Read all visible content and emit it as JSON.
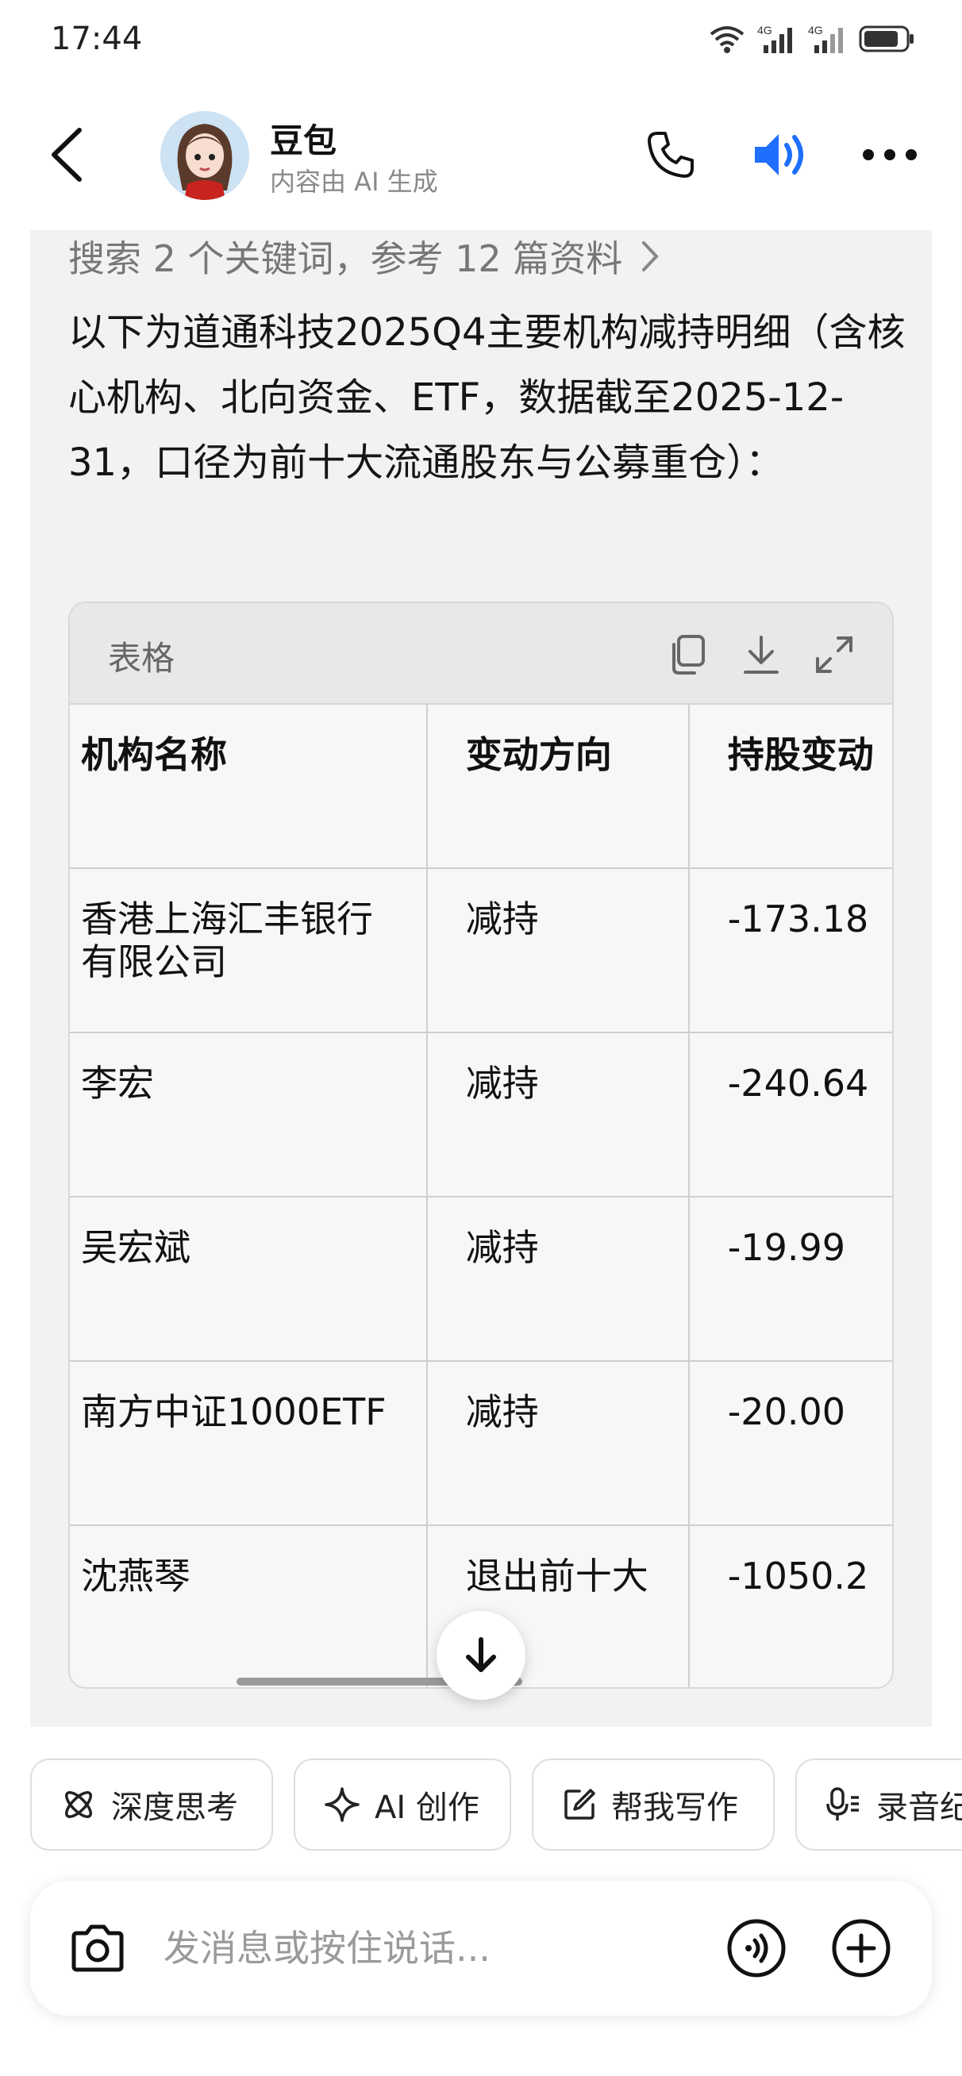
{
  "status_bar": {
    "time": "17:44",
    "icons": [
      "wifi-icon",
      "signal-4g-icon",
      "signal-4g-icon",
      "battery-icon"
    ]
  },
  "header": {
    "bot_name": "豆包",
    "subtitle": "内容由 AI 生成",
    "icons": [
      "back-icon",
      "phone-icon",
      "speaker-icon",
      "more-icon"
    ],
    "accent_color": "#1e6fff"
  },
  "message": {
    "search_reference": "搜索 2 个关键词，参考 12 篇资料",
    "text": "以下为道通科技2025Q4主要机构减持明细（含核心机构、北向资金、ETF，数据截至2025-12-31，口径为前十大流通股东与公募重仓）："
  },
  "table": {
    "toolbar_label": "表格",
    "toolbar_icons": [
      "copy-icon",
      "download-icon",
      "expand-icon"
    ],
    "headers": [
      "机构名称",
      "变动方向",
      "持股变动"
    ],
    "rows": [
      [
        "香港上海汇丰银行有限公司",
        "减持",
        "-173.18"
      ],
      [
        "李宏",
        "减持",
        "-240.64"
      ],
      [
        "吴宏斌",
        "减持",
        "-19.99"
      ],
      [
        "南方中证1000ETF",
        "减持",
        "-20.00"
      ],
      [
        "沈燕琴",
        "退出前十大",
        "-1050.2"
      ]
    ]
  },
  "chips": [
    {
      "label": "深度思考",
      "icon": "atom-icon"
    },
    {
      "label": "AI 创作",
      "icon": "sparkle-icon"
    },
    {
      "label": "帮我写作",
      "icon": "edit-icon"
    },
    {
      "label": "录音纪要",
      "icon": "mic-icon"
    }
  ],
  "input": {
    "placeholder": "发消息或按住说话..."
  }
}
